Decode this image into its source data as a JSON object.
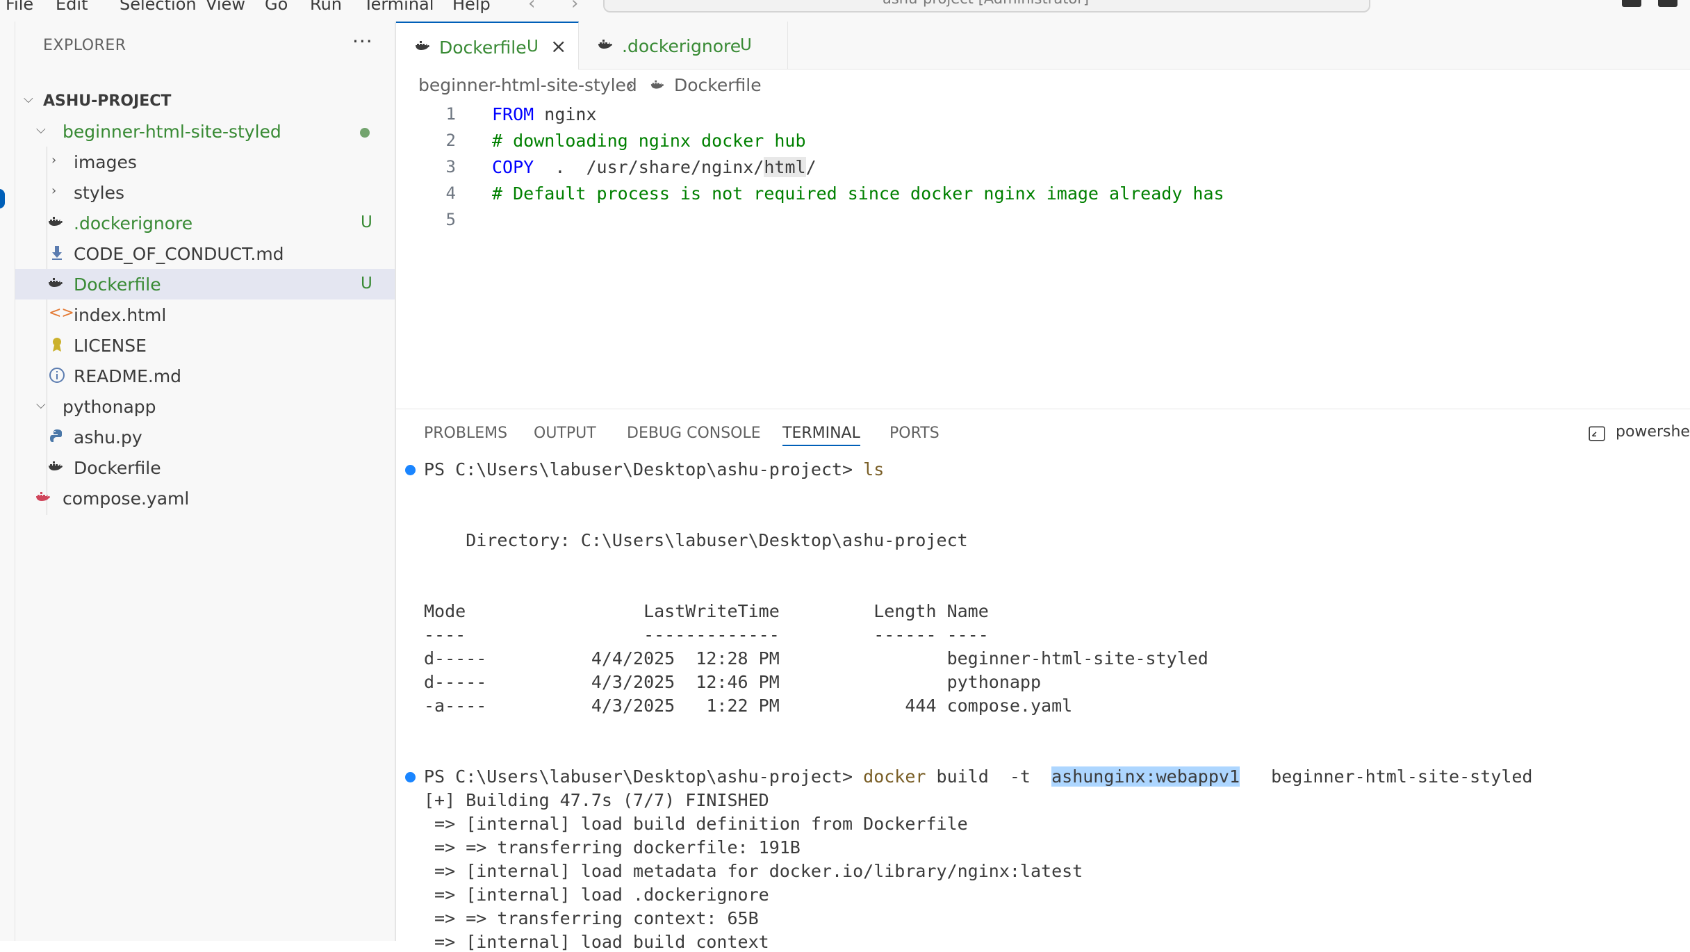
{
  "menu": {
    "file": "File",
    "edit": "Edit",
    "selection": "Selection",
    "view": "View",
    "go": "Go",
    "run": "Run",
    "terminal": "Terminal",
    "help": "Help"
  },
  "command_center": {
    "label": "ashu-project [Administrator]"
  },
  "explorer": {
    "title": "EXPLORER",
    "more": "···",
    "project": "ASHU-PROJECT",
    "items": [
      {
        "label": "beginner-html-site-styled",
        "badge": ""
      },
      {
        "label": "images",
        "badge": ""
      },
      {
        "label": "styles",
        "badge": ""
      },
      {
        "label": ".dockerignore",
        "badge": "U"
      },
      {
        "label": "CODE_OF_CONDUCT.md",
        "badge": ""
      },
      {
        "label": "Dockerfile",
        "badge": "U"
      },
      {
        "label": "index.html",
        "badge": ""
      },
      {
        "label": "LICENSE",
        "badge": ""
      },
      {
        "label": "README.md",
        "badge": ""
      },
      {
        "label": "pythonapp",
        "badge": ""
      },
      {
        "label": "ashu.py",
        "badge": ""
      },
      {
        "label": "Dockerfile",
        "badge": ""
      },
      {
        "label": "compose.yaml",
        "badge": ""
      }
    ]
  },
  "tabs": [
    {
      "label": "Dockerfile",
      "badge": "U",
      "close": "×"
    },
    {
      "label": ".dockerignore",
      "badge": "U"
    }
  ],
  "breadcrumb": {
    "folder": "beginner-html-site-styled",
    "sep": "›",
    "file": "Dockerfile"
  },
  "editor": {
    "lines": [
      {
        "n": "1",
        "kw": "FROM",
        "rest": " nginx"
      },
      {
        "n": "2",
        "comment": "# downloading nginx docker hub"
      },
      {
        "n": "3",
        "kw": "COPY",
        "rest": "  .  /usr/share/nginx/",
        "hl": "html",
        "tail": "/"
      },
      {
        "n": "4",
        "comment": "# Default process is not required since docker nginx image already has"
      },
      {
        "n": "5"
      }
    ]
  },
  "panel": {
    "tabs": {
      "problems": "PROBLEMS",
      "output": "OUTPUT",
      "debug": "DEBUG CONSOLE",
      "terminal": "TERMINAL",
      "ports": "PORTS"
    },
    "shell": "powershell"
  },
  "terminal": {
    "prompt1": "PS C:\\Users\\labuser\\Desktop\\ashu-project> ",
    "cmd1": "ls",
    "directory": "    Directory: C:\\Users\\labuser\\Desktop\\ashu-project",
    "header": "Mode                 LastWriteTime         Length Name",
    "underline": "----                 -------------         ------ ----",
    "rows": [
      "d-----          4/4/2025  12:28 PM                beginner-html-site-styled",
      "d-----          4/3/2025  12:46 PM                pythonapp",
      "-a----          4/3/2025   1:22 PM            444 compose.yaml"
    ],
    "prompt2": "PS C:\\Users\\labuser\\Desktop\\ashu-project> ",
    "cmd2_a": "docker",
    "cmd2_b": " build  -t  ",
    "cmd2_sel": "ashunginx:webappv1",
    "cmd2_c": "   beginner-html-site-styled",
    "build": [
      "[+] Building 47.7s (7/7) FINISHED",
      " => [internal] load build definition from Dockerfile",
      " => => transferring dockerfile: 191B",
      " => [internal] load metadata for docker.io/library/nginx:latest",
      " => [internal] load .dockerignore",
      " => => transferring context: 65B",
      " => [internal] load build context"
    ]
  }
}
